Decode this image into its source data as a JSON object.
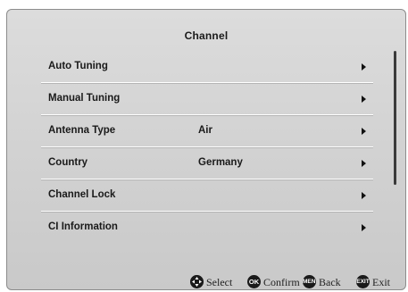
{
  "menu": {
    "title": "Channel",
    "items": [
      {
        "label": "Auto Tuning",
        "value": ""
      },
      {
        "label": "Manual Tuning",
        "value": ""
      },
      {
        "label": "Antenna Type",
        "value": "Air"
      },
      {
        "label": "Country",
        "value": "Germany"
      },
      {
        "label": "Channel Lock",
        "value": ""
      },
      {
        "label": "CI Information",
        "value": ""
      }
    ]
  },
  "help_bar": {
    "select": {
      "icon": "dpad-icon",
      "label": "Select"
    },
    "confirm": {
      "icon": "ok-button-icon",
      "icon_text": "OK",
      "label": "Confirm"
    },
    "back": {
      "icon": "menu-button-icon",
      "icon_text": "MENU",
      "label": "Back"
    },
    "exit": {
      "icon": "exit-button-icon",
      "icon_text": "EXIT",
      "label": "Exit"
    }
  },
  "colors": {
    "panel_background": "#d4d4d4",
    "text": "#1a1a1a",
    "icon_background": "#1a1a1a"
  }
}
